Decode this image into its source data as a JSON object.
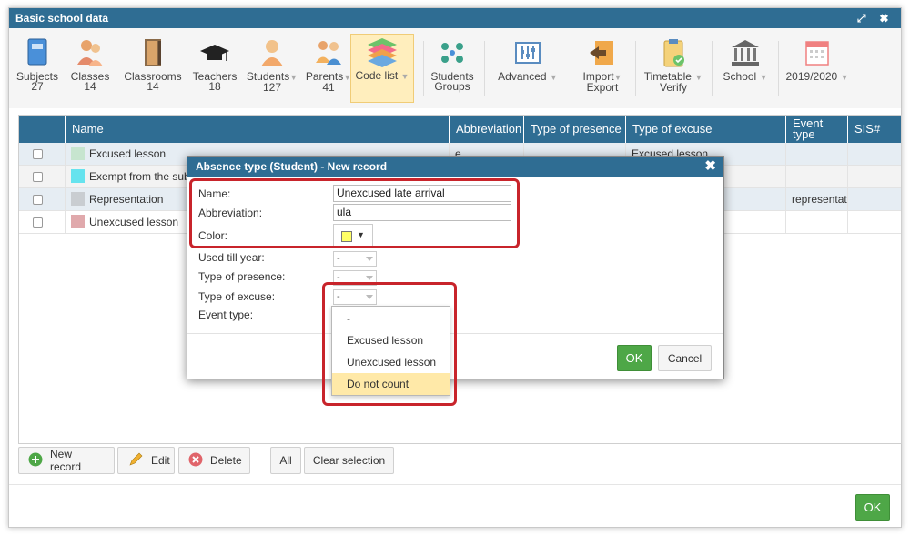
{
  "window": {
    "title": "Basic school data",
    "controls": "⤢ ✖"
  },
  "toolbar": {
    "items": [
      {
        "label": "Subjects",
        "sub": "27"
      },
      {
        "label": "Classes",
        "sub": "14"
      },
      {
        "label": "Classrooms",
        "sub": "14"
      },
      {
        "label": "Teachers",
        "sub": "18"
      },
      {
        "label": "Students",
        "sub": "127"
      },
      {
        "label": "Parents",
        "sub": "41"
      },
      {
        "label": "Code list",
        "sub": ""
      },
      {
        "label": "Students",
        "sub": "Groups"
      },
      {
        "label": "Advanced",
        "sub": ""
      },
      {
        "label": "Import",
        "sub": "Export"
      },
      {
        "label": "Timetable",
        "sub": "Verify"
      },
      {
        "label": "School",
        "sub": ""
      },
      {
        "label": "2019/2020",
        "sub": ""
      }
    ],
    "arrow": "▼"
  },
  "grid": {
    "headers": [
      "Name",
      "Abbreviation",
      "Type of presence",
      "Type of excuse",
      "Event type",
      "SIS#"
    ],
    "rows": [
      {
        "name": "Excused lesson",
        "abbr": "e",
        "presence": "",
        "excuse": "Excused lesson",
        "event": "",
        "sis": "",
        "color": "#c7e5cf"
      },
      {
        "name": "Exempt from the subject",
        "abbr": "",
        "presence": "",
        "excuse": "",
        "event": "",
        "sis": "",
        "color": "#66e3ee"
      },
      {
        "name": "Representation",
        "abbr": "",
        "presence": "",
        "excuse": "",
        "event": "representation",
        "sis": "",
        "color": "#c9cdd1"
      },
      {
        "name": "Unexcused lesson",
        "abbr": "",
        "presence": "",
        "excuse": "",
        "event": "",
        "sis": "",
        "color": "#e0a9ac"
      }
    ]
  },
  "buttons": {
    "new_record": "New record",
    "edit": "Edit",
    "delete": "Delete",
    "all": "All",
    "clear_selection": "Clear selection",
    "ok": "OK"
  },
  "dialog": {
    "title": "Absence type (Student) - New record",
    "close": "✖",
    "fields": {
      "name_label": "Name:",
      "name_value": "Unexcused late arrival",
      "abbr_label": "Abbreviation:",
      "abbr_value": "ula",
      "color_label": "Color:",
      "used_till_label": "Used till year:",
      "used_till_value": "-",
      "presence_label": "Type of presence:",
      "presence_value": "-",
      "excuse_label": "Type of excuse:",
      "excuse_value": "-",
      "event_label": "Event type:"
    },
    "ok": "OK",
    "cancel": "Cancel",
    "dropdown_options": [
      "-",
      "Excused lesson",
      "Unexcused lesson",
      "Do not count"
    ],
    "dropdown_highlighted": "Do not count"
  },
  "colors": {
    "header": "#2f6d93",
    "ok_green": "#4ea747",
    "highlight": "#ffe9a8",
    "annotation_red": "#c8242b",
    "color_value": "#ffff66"
  },
  "icons": [
    "book-icon",
    "classes-icon",
    "door-icon",
    "graduation-cap-icon",
    "student-icon",
    "parents-icon",
    "stack-icon",
    "groups-icon",
    "sliders-icon",
    "import-icon",
    "clipboard-icon",
    "building-icon",
    "calendar-icon",
    "plus-icon",
    "pencil-icon",
    "delete-icon"
  ]
}
